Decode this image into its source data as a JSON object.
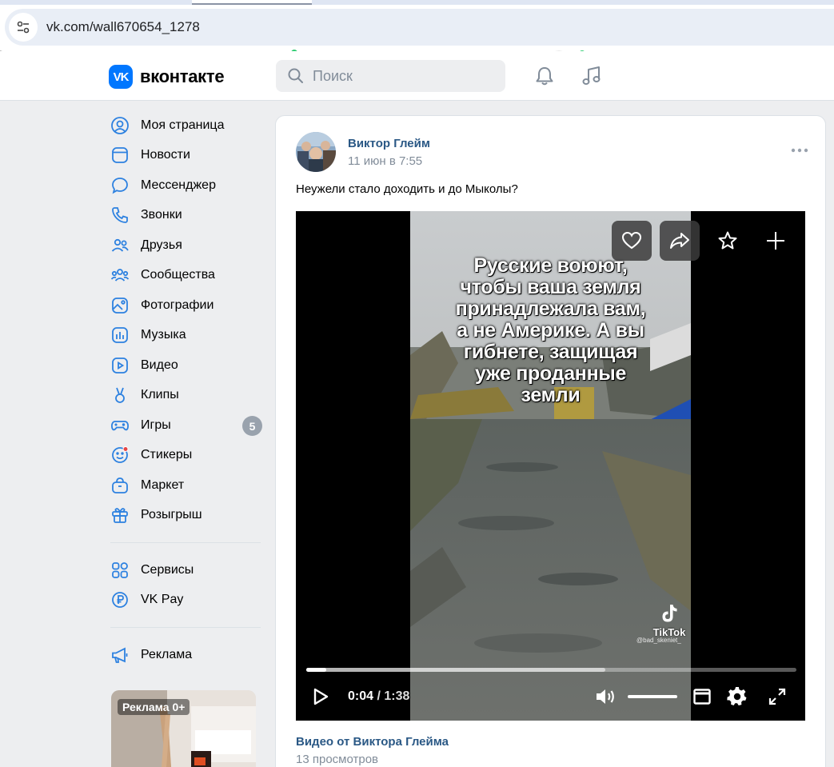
{
  "browser": {
    "url": "vk.com/wall670654_1278"
  },
  "header": {
    "logo_text": "вконтакте",
    "logo_mark": "VK",
    "search_placeholder": "Поиск",
    "icons": [
      "bell-icon",
      "music-icon"
    ]
  },
  "sidebar": {
    "items": [
      {
        "label": "Моя страница",
        "icon": "profile-icon"
      },
      {
        "label": "Новости",
        "icon": "news-icon"
      },
      {
        "label": "Мессенджер",
        "icon": "messenger-icon"
      },
      {
        "label": "Звонки",
        "icon": "phone-icon"
      },
      {
        "label": "Друзья",
        "icon": "friends-icon"
      },
      {
        "label": "Сообщества",
        "icon": "communities-icon"
      },
      {
        "label": "Фотографии",
        "icon": "photos-icon"
      },
      {
        "label": "Музыка",
        "icon": "music-icon"
      },
      {
        "label": "Видео",
        "icon": "video-icon"
      },
      {
        "label": "Клипы",
        "icon": "clips-icon"
      },
      {
        "label": "Игры",
        "icon": "games-icon",
        "badge": "5"
      },
      {
        "label": "Стикеры",
        "icon": "stickers-icon"
      },
      {
        "label": "Маркет",
        "icon": "market-icon"
      },
      {
        "label": "Розыгрыш",
        "icon": "gift-icon"
      }
    ],
    "secondary": [
      {
        "label": "Сервисы",
        "icon": "services-icon"
      },
      {
        "label": "VK Pay",
        "icon": "vkpay-icon"
      }
    ],
    "tertiary": [
      {
        "label": "Реклама",
        "icon": "megaphone-icon"
      }
    ],
    "ad_label": "Реклама 0+"
  },
  "post": {
    "author": "Виктор Глейм",
    "date": "11 июн в 7:55",
    "text": "Неужели стало доходить и до Мыколы?",
    "video": {
      "overlay_text": [
        "Русские воюют,",
        "чтобы ваша земля",
        "принадлежала вам,",
        "а не Америке. А вы",
        "гибнете, защищая",
        "уже проданные",
        "земли"
      ],
      "watermark": "TikTok",
      "watermark_user": "@bad_skeniet_",
      "current_time": "0:04",
      "separator": " / ",
      "duration": "1:38",
      "progress": 0.041,
      "buffered": 0.61,
      "volume": 1.0
    },
    "video_title": "Видео от Виктора Глейма",
    "views": "13 просмотров"
  },
  "colors": {
    "accent": "#0077ff",
    "link": "#2a5885",
    "muted": "#818c99",
    "page_bg": "#edeef0"
  }
}
